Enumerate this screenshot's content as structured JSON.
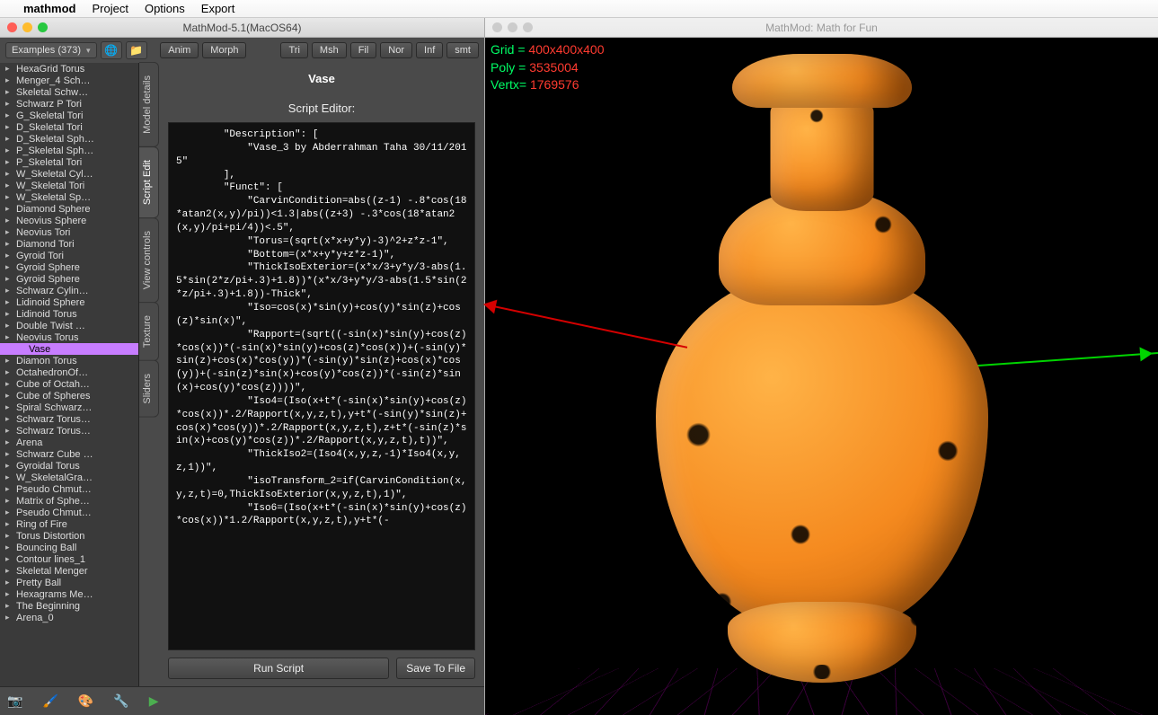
{
  "menubar": {
    "app": "mathmod",
    "items": [
      "Project",
      "Options",
      "Export"
    ]
  },
  "left_window": {
    "title": "MathMod-5.1(MacOS64)",
    "examples_label": "Examples (373)",
    "anim": "Anim",
    "morph": "Morph",
    "tri": "Tri",
    "msh": "Msh",
    "fil": "Fil",
    "nor": "Nor",
    "inf": "Inf",
    "smt": "smt",
    "model_name": "Vase",
    "side_tabs": [
      "Model details",
      "Script Edit",
      "View controls",
      "Texture",
      "Sliders"
    ],
    "editor_label": "Script Editor:",
    "run": "Run Script",
    "save": "Save To File"
  },
  "tree": [
    "HexaGrid Torus",
    "Menger_4 Sch…",
    "Skeletal Schw…",
    "Schwarz P Tori",
    "G_Skeletal Tori",
    "D_Skeletal Tori",
    "D_Skeletal Sph…",
    "P_Skeletal Sph…",
    "P_Skeletal Tori",
    "W_Skeletal Cyl…",
    "W_Skeletal Tori",
    "W_Skeletal Sp…",
    "Diamond Sphere",
    "Neovius Sphere",
    "Neovius Tori",
    "Diamond Tori",
    "Gyroid Tori",
    "Gyroid Sphere",
    "Gyroid Sphere",
    "Schwarz Cylin…",
    "Lidinoid Sphere",
    "Lidinoid Torus",
    "Double Twist …",
    "Neovius Torus",
    "Vase",
    "Diamon Torus",
    "OctahedronOf…",
    "Cube of Octah…",
    "Cube of Spheres",
    "Spiral Schwarz…",
    "Schwarz Torus…",
    "Schwarz Torus…",
    "Arena",
    "Schwarz Cube …",
    "Gyroidal Torus",
    "W_SkeletalGra…",
    "Pseudo Chmut…",
    "Matrix of Sphe…",
    "Pseudo Chmut…",
    "Ring of Fire",
    "Torus Distortion",
    "Bouncing Ball",
    "Contour lines_1",
    "Skeletal Menger",
    "Pretty Ball",
    "Hexagrams Me…",
    "The Beginning",
    "Arena_0"
  ],
  "tree_selected": "Vase",
  "script": "        \"Description\": [\n            \"Vase_3 by Abderrahman Taha 30/11/2015\"\n        ],\n        \"Funct\": [\n            \"CarvinCondition=abs((z-1) -.8*cos(18*atan2(x,y)/pi))<1.3|abs((z+3) -.3*cos(18*atan2(x,y)/pi+pi/4))<.5\",\n            \"Torus=(sqrt(x*x+y*y)-3)^2+z*z-1\",\n            \"Bottom=(x*x+y*y+z*z-1)\",\n            \"ThickIsoExterior=(x*x/3+y*y/3-abs(1.5*sin(2*z/pi+.3)+1.8))*(x*x/3+y*y/3-abs(1.5*sin(2*z/pi+.3)+1.8))-Thick\",\n            \"Iso=cos(x)*sin(y)+cos(y)*sin(z)+cos(z)*sin(x)\",\n            \"Rapport=(sqrt((-sin(x)*sin(y)+cos(z)*cos(x))*(-sin(x)*sin(y)+cos(z)*cos(x))+(-sin(y)*sin(z)+cos(x)*cos(y))*(-sin(y)*sin(z)+cos(x)*cos(y))+(-sin(z)*sin(x)+cos(y)*cos(z))*(-sin(z)*sin(x)+cos(y)*cos(z))))\",\n            \"Iso4=(Iso(x+t*(-sin(x)*sin(y)+cos(z)*cos(x))*.2/Rapport(x,y,z,t),y+t*(-sin(y)*sin(z)+cos(x)*cos(y))*.2/Rapport(x,y,z,t),z+t*(-sin(z)*sin(x)+cos(y)*cos(z))*.2/Rapport(x,y,z,t),t))\",\n            \"ThickIso2=(Iso4(x,y,z,-1)*Iso4(x,y,z,1))\",\n            \"isoTransform_2=if(CarvinCondition(x,y,z,t)=0,ThickIsoExterior(x,y,z,t),1)\",\n            \"Iso6=(Iso(x+t*(-sin(x)*sin(y)+cos(z)*cos(x))*1.2/Rapport(x,y,z,t),y+t*(-",
  "right_window": {
    "title": "MathMod: Math for Fun",
    "grid_label": "Grid =",
    "grid_value": "400x400x400",
    "poly_label": "Poly =",
    "poly_value": "3535004",
    "vert_label": "Vertx=",
    "vert_value": "1769576"
  }
}
